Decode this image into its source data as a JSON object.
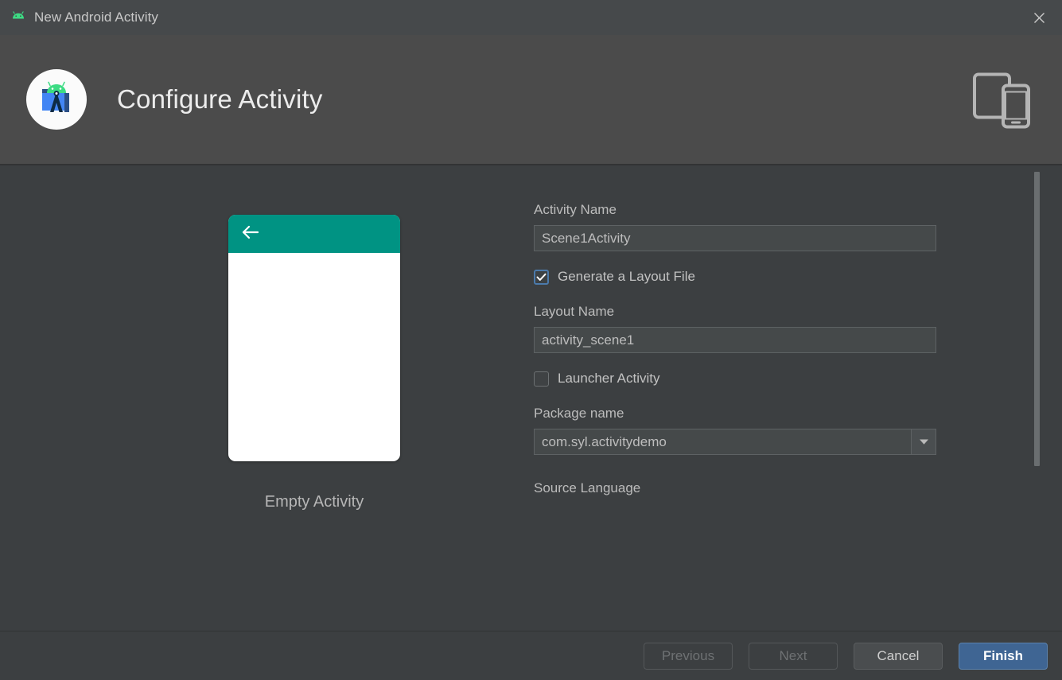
{
  "window": {
    "title": "New Android Activity",
    "icon": "android-head-icon",
    "close_icon": "close-icon"
  },
  "header": {
    "title": "Configure Activity",
    "logo_icon": "android-studio-logo-icon",
    "device_icon": "tablet-and-phone-icon"
  },
  "preview": {
    "caption": "Empty Activity",
    "appbar_color": "#009383",
    "back_icon": "back-arrow-icon"
  },
  "form": {
    "activity_name": {
      "label": "Activity Name",
      "value": "Scene1Activity"
    },
    "generate_layout": {
      "label": "Generate a Layout File",
      "checked": "true"
    },
    "layout_name": {
      "label": "Layout Name",
      "value": "activity_scene1"
    },
    "launcher_activity": {
      "label": "Launcher Activity",
      "checked": "false"
    },
    "package_name": {
      "label": "Package name",
      "value": "com.syl.activitydemo",
      "dropdown_icon": "chevron-down-icon"
    },
    "source_language": {
      "label": "Source Language"
    }
  },
  "footer": {
    "previous": "Previous",
    "next": "Next",
    "cancel": "Cancel",
    "finish": "Finish"
  },
  "colors": {
    "accent": "#3f6593",
    "teal": "#009383",
    "checkbox_blue": "#4b7aab"
  }
}
